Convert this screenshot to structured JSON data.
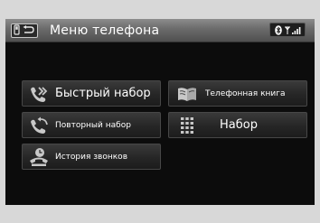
{
  "header": {
    "title": "Меню телефона",
    "back_icon": "phone-back-icon",
    "status_icons": [
      "bluetooth-icon",
      "signal-strength-icon"
    ]
  },
  "menu": {
    "speed_dial": {
      "label": "Быстрый набор",
      "icon": "speed-dial-icon"
    },
    "redial": {
      "label": "Повторный набор",
      "icon": "redial-icon"
    },
    "call_history": {
      "label": "История звонков",
      "icon": "call-history-icon"
    },
    "phonebook": {
      "label": "Телефонная книга",
      "icon": "phonebook-icon"
    },
    "dial": {
      "label": "Набор",
      "icon": "keypad-icon"
    }
  },
  "colors": {
    "screen_bg": "#0c0c0c",
    "header_bg": "#6a6a6a",
    "button_bg": "#262626",
    "text": "#ffffff",
    "frame": "#d8d8d8"
  }
}
